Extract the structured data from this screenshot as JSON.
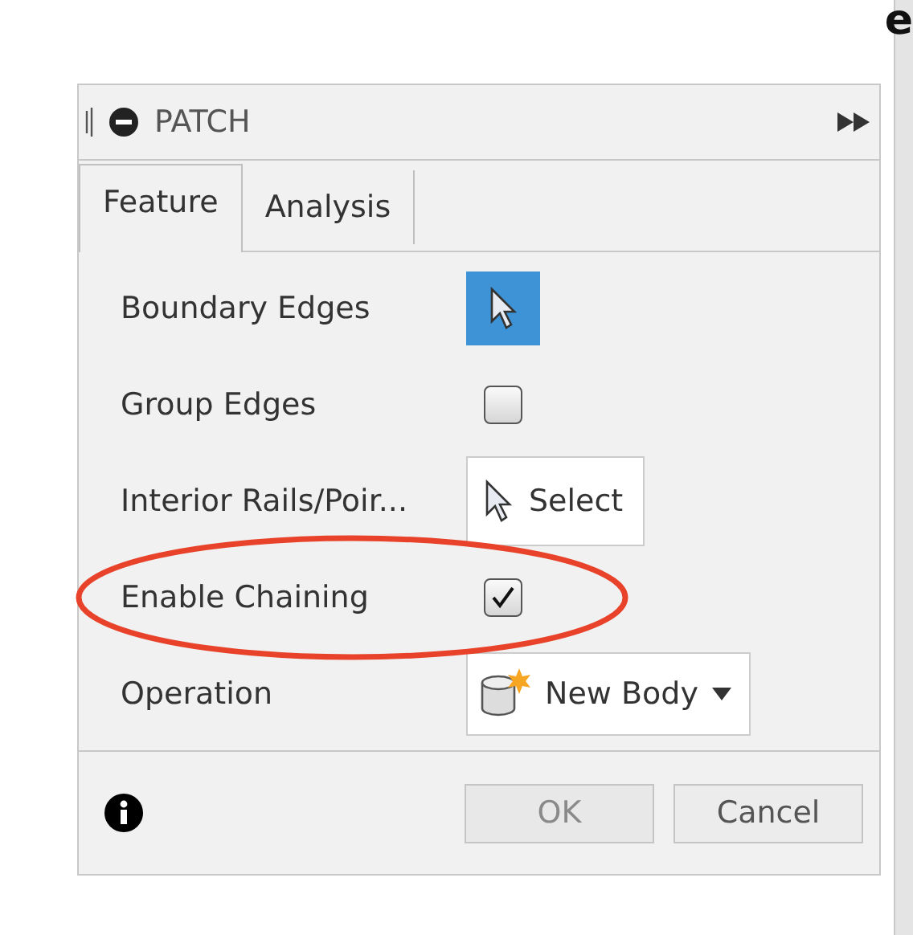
{
  "edge_text": "e",
  "panel": {
    "title": "PATCH",
    "tabs": [
      {
        "label": "Feature",
        "selected": true
      },
      {
        "label": "Analysis",
        "selected": false
      }
    ],
    "rows": [
      {
        "kind": "selection",
        "label": "Boundary Edges",
        "active": true
      },
      {
        "kind": "checkbox",
        "label": "Group Edges",
        "checked": false
      },
      {
        "kind": "select",
        "label": "Interior Rails/Poir...",
        "button": "Select"
      },
      {
        "kind": "checkbox",
        "label": "Enable Chaining",
        "checked": true,
        "highlighted": true
      },
      {
        "kind": "dropdown",
        "label": "Operation",
        "value": "New Body"
      }
    ],
    "buttons": [
      {
        "label": "OK",
        "disabled": true
      },
      {
        "label": "Cancel",
        "disabled": false
      }
    ]
  }
}
